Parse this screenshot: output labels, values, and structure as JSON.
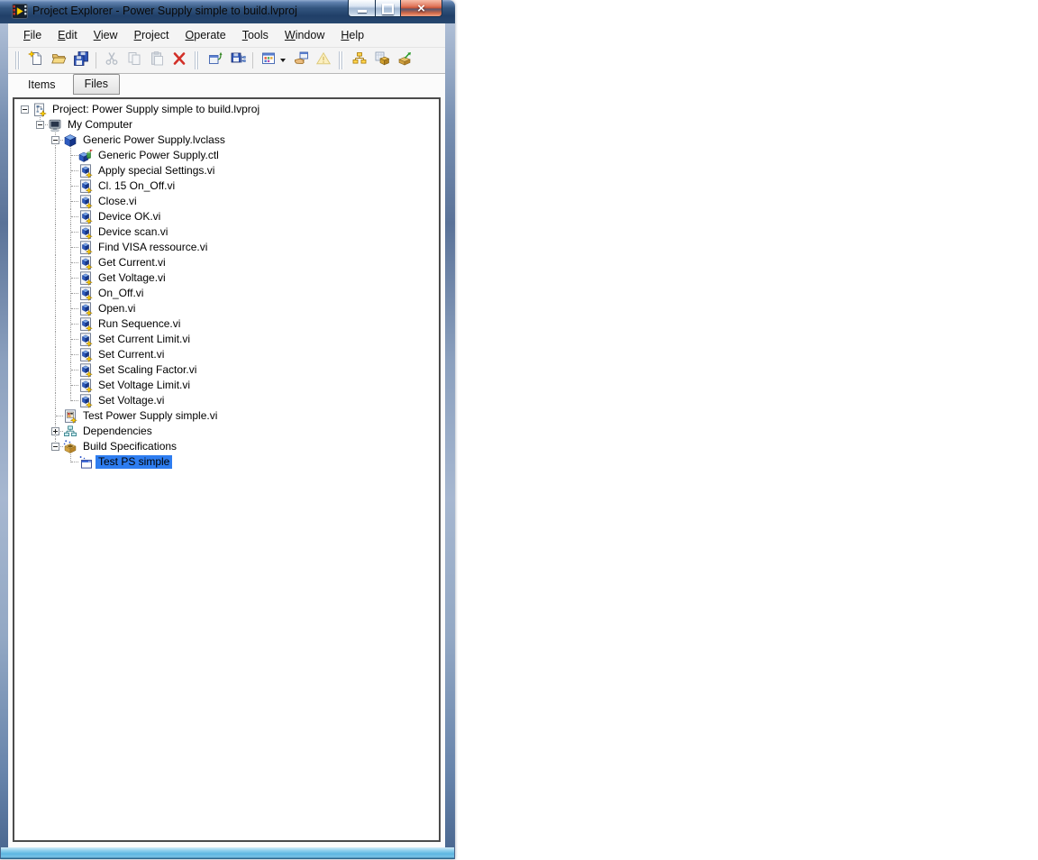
{
  "window": {
    "title": "Project Explorer - Power Supply simple to build.lvproj",
    "app_icon": "labview-icon",
    "caption_buttons": [
      {
        "name": "minimize",
        "icon": "minimize-icon"
      },
      {
        "name": "maximize",
        "icon": "maximize-icon"
      },
      {
        "name": "close",
        "icon": "close-icon"
      }
    ]
  },
  "menu_bar": {
    "items": [
      "File",
      "Edit",
      "View",
      "Project",
      "Operate",
      "Tools",
      "Window",
      "Help"
    ]
  },
  "toolbar": {
    "items": [
      {
        "kind": "grip"
      },
      {
        "kind": "button",
        "icon": "new-file-icon",
        "enabled": true
      },
      {
        "kind": "button",
        "icon": "open-folder-icon",
        "enabled": true
      },
      {
        "kind": "button",
        "icon": "save-all-icon",
        "enabled": true
      },
      {
        "kind": "sep"
      },
      {
        "kind": "button",
        "icon": "cut-icon",
        "enabled": false
      },
      {
        "kind": "button",
        "icon": "copy-icon",
        "enabled": false
      },
      {
        "kind": "button",
        "icon": "paste-icon",
        "enabled": false
      },
      {
        "kind": "button",
        "icon": "delete-icon",
        "enabled": true
      },
      {
        "kind": "grip"
      },
      {
        "kind": "button",
        "icon": "refresh-hierarchy-icon",
        "enabled": true
      },
      {
        "kind": "button",
        "icon": "save-hierarchy-icon",
        "enabled": true
      },
      {
        "kind": "sep"
      },
      {
        "kind": "button",
        "icon": "icon-view-icon",
        "enabled": true,
        "dropdown": true
      },
      {
        "kind": "button",
        "icon": "hand-window-icon",
        "enabled": true
      },
      {
        "kind": "button",
        "icon": "warning-icon",
        "enabled": false
      },
      {
        "kind": "grip"
      },
      {
        "kind": "button",
        "icon": "resolve-conflicts-icon",
        "enabled": true
      },
      {
        "kind": "button",
        "icon": "build-box-icon",
        "enabled": true
      },
      {
        "kind": "button",
        "icon": "deploy-box-icon",
        "enabled": true
      }
    ]
  },
  "tabs": {
    "items": [
      {
        "label": "Items",
        "active": true
      },
      {
        "label": "Files",
        "active": false
      }
    ]
  },
  "tree": {
    "root": {
      "label": "Project: Power Supply simple to build.lvproj",
      "icon": "project-icon",
      "expanded": true,
      "children": [
        {
          "label": "My Computer",
          "icon": "computer-icon",
          "expanded": true,
          "children": [
            {
              "label": "Generic Power Supply.lvclass",
              "icon": "lvclass-icon",
              "expanded": true,
              "children": [
                {
                  "label": "Generic Power Supply.ctl",
                  "icon": "ctl-icon"
                },
                {
                  "label": "Apply special Settings.vi",
                  "icon": "vi-icon"
                },
                {
                  "label": "Cl. 15 On_Off.vi",
                  "icon": "vi-icon"
                },
                {
                  "label": "Close.vi",
                  "icon": "vi-icon"
                },
                {
                  "label": "Device OK.vi",
                  "icon": "vi-icon"
                },
                {
                  "label": "Device scan.vi",
                  "icon": "vi-icon"
                },
                {
                  "label": "Find VISA ressource.vi",
                  "icon": "vi-icon"
                },
                {
                  "label": "Get Current.vi",
                  "icon": "vi-icon"
                },
                {
                  "label": "Get Voltage.vi",
                  "icon": "vi-icon"
                },
                {
                  "label": "On_Off.vi",
                  "icon": "vi-icon"
                },
                {
                  "label": "Open.vi",
                  "icon": "vi-icon"
                },
                {
                  "label": "Run Sequence.vi",
                  "icon": "vi-icon"
                },
                {
                  "label": "Set Current Limit.vi",
                  "icon": "vi-icon"
                },
                {
                  "label": "Set Current.vi",
                  "icon": "vi-icon"
                },
                {
                  "label": "Set Scaling Factor.vi",
                  "icon": "vi-icon"
                },
                {
                  "label": "Set Voltage Limit.vi",
                  "icon": "vi-icon"
                },
                {
                  "label": "Set Voltage.vi",
                  "icon": "vi-icon"
                }
              ]
            },
            {
              "label": "Test Power Supply simple.vi",
              "icon": "vi-main-icon"
            },
            {
              "label": "Dependencies",
              "icon": "dependencies-icon",
              "expanded": false,
              "has_children": true
            },
            {
              "label": "Build Specifications",
              "icon": "build-specs-icon",
              "expanded": true,
              "children": [
                {
                  "label": "Test PS simple",
                  "icon": "exe-icon",
                  "selected": true
                }
              ]
            }
          ]
        }
      ]
    }
  },
  "colors": {
    "titlebar_top": "#93add1",
    "titlebar_bottom": "#28486f",
    "frame_blue": "#8ba0be",
    "bottom_border_blue": "#5cb5e1",
    "close_button_red": "#c34c30",
    "selection_blue": "#2e7df0",
    "chrome_gray": "#f4f4f4",
    "tree_background": "#ffffff"
  }
}
